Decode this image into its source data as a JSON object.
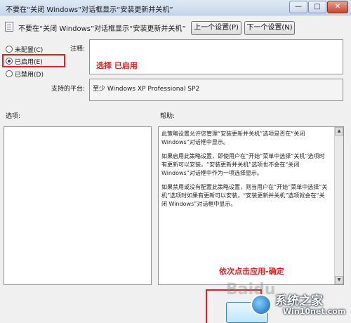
{
  "window": {
    "title": "不要在“关闭 Windows”对话框显示“安装更新并关机”",
    "minimize_glyph": "—",
    "maximize_glyph": "□",
    "close_glyph": "✕"
  },
  "header": {
    "policy_title": "不要在“关闭 Windows”对话框显示“安装更新并关机”",
    "prev_button": "上一个设置(P)",
    "next_button": "下一个设置(N)"
  },
  "state_options": {
    "items": [
      {
        "label": "未配置(C)",
        "checked": false
      },
      {
        "label": "已启用(E)",
        "checked": true
      },
      {
        "label": "已禁用(D)",
        "checked": false
      }
    ]
  },
  "comment": {
    "label": "注释:",
    "value": ""
  },
  "supported": {
    "label": "支持的平台:",
    "value": "至少 Windows XP Professional SP2"
  },
  "options": {
    "label": "选项:"
  },
  "help": {
    "label": "帮助:",
    "paragraphs": [
      "此策略设置允许您管理“安装更新并关机”选项是否在“关闭 Windows”对话框中显示。",
      "如果启用此策略设置，即使用户在“开始”菜单中选择“关机”选项时有更新可以安装，“安装更新并关机”选项也不会在“关闭 Windows”对话框中作为一项选择显示。",
      "如果禁用或没有配置此策略设置，则当用户在“开始”菜单中选择“关机”选项时如果有更新可以安装，“安装更新并关机”选项就会在“关闭 Windows”对话框中显示。"
    ],
    "scroll_up_glyph": "▲",
    "scroll_down_glyph": "▼"
  },
  "annotations": {
    "select_enabled": "选择 已启用",
    "click_apply_ok": "依次点击应用-确定"
  },
  "watermark": {
    "faint": "Baidu",
    "brand": "系统之家",
    "site": "Win10net.com"
  },
  "colors": {
    "annotation_red": "#e02020",
    "titlebar": "#c5d6ec"
  }
}
